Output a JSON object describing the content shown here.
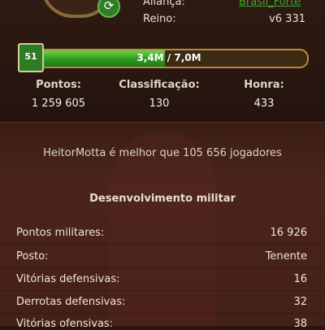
{
  "profile": {
    "alliance_label": "Aliança:",
    "alliance_value": "Brasil_Forte",
    "realm_label": "Reino:",
    "realm_value": "v6 331",
    "level": "51",
    "xp_text": "3,4M / 7,0M",
    "xp_progress": 0.486
  },
  "stats": {
    "points_label": "Pontos:",
    "points_value": "1 259 605",
    "rank_label": "Classificação:",
    "rank_value": "130",
    "honor_label": "Honra:",
    "honor_value": "433"
  },
  "comparison": "HeitorMotta é melhor que 105 656 jogadores",
  "military": {
    "title": "Desenvolvimento militar",
    "rows": [
      {
        "label": "Pontos militares:",
        "value": "16 926"
      },
      {
        "label": "Posto:",
        "value": "Tenente"
      },
      {
        "label": "Vitórias defensivas:",
        "value": "16"
      },
      {
        "label": "Derrotas defensivas:",
        "value": "32"
      },
      {
        "label": "Vitórias ofensivas:",
        "value": "38"
      }
    ]
  },
  "colors": {
    "xp_green": "#2e9a1e",
    "alliance_link": "#3da52d",
    "accent_gold": "#b88a3c"
  }
}
